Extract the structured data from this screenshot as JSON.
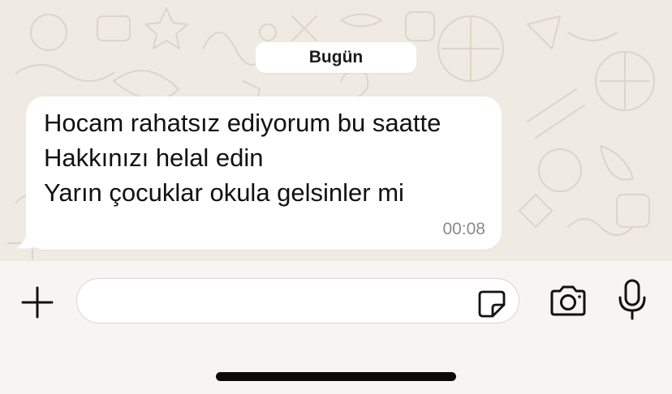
{
  "chat": {
    "date_label": "Bugün",
    "message": {
      "lines": [
        "Hocam rahatsız ediyorum bu saatte",
        "Hakkınızı helal edin",
        "Yarın çocuklar okula gelsinler mi"
      ],
      "time": "00:08"
    }
  },
  "composer": {
    "input_value": "",
    "icons": {
      "plus": "plus-icon",
      "sticker": "sticker-icon",
      "camera": "camera-icon",
      "mic": "microphone-icon"
    }
  },
  "colors": {
    "wallpaper": "#efeae2",
    "bubble": "#ffffff",
    "composer_bg": "#f6f5f3",
    "time_text": "#8a8a8d"
  }
}
